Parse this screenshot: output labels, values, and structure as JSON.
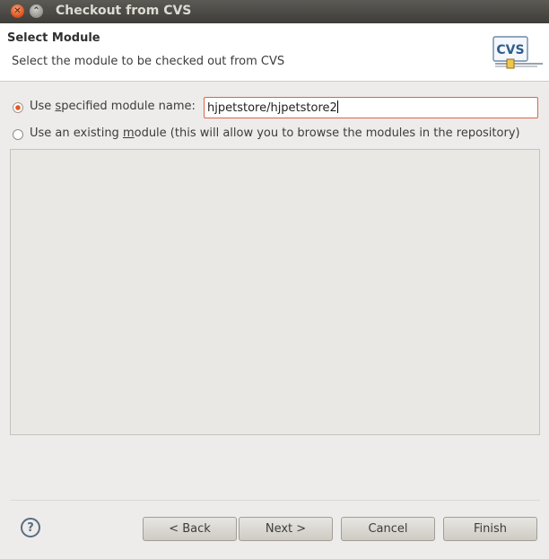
{
  "window": {
    "title": "Checkout from CVS",
    "close_icon": "close-icon",
    "maximize_icon": "maximize-icon"
  },
  "header": {
    "title": "Select Module",
    "description": "Select the module to be checked out from CVS",
    "logo_text": "CVS"
  },
  "options": {
    "specified": {
      "label_pre": "Use ",
      "label_mnemonic": "s",
      "label_post": "pecified module name:",
      "selected": true
    },
    "existing": {
      "label_pre": "Use an existing ",
      "label_mnemonic": "m",
      "label_post": "odule (this will allow you to browse the modules in the repository)",
      "selected": false
    }
  },
  "module_name": {
    "value": "hjpetstore/hjpetstore2"
  },
  "buttons": {
    "help": "?",
    "back": "< Back",
    "next": "Next >",
    "cancel": "Cancel",
    "finish": "Finish"
  },
  "colors": {
    "accent": "#e05a22",
    "titlebar": "#3e3d39",
    "background": "#edeceb"
  }
}
